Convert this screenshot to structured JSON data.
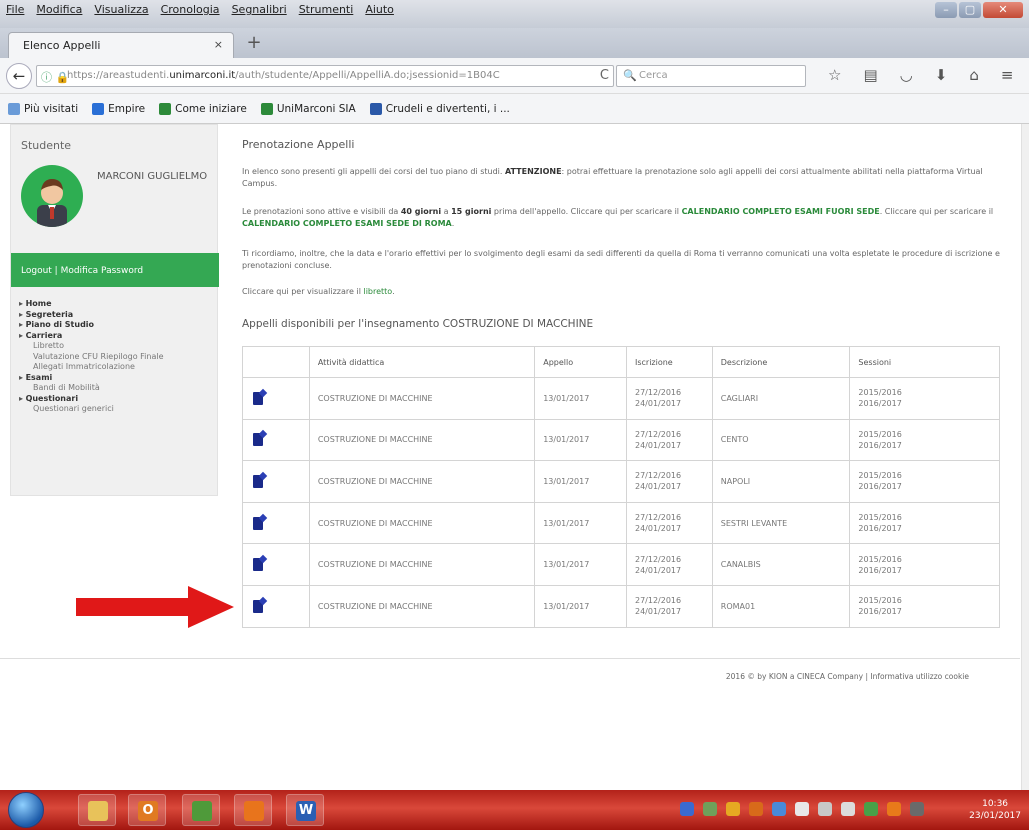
{
  "menu": [
    "File",
    "Modifica",
    "Visualizza",
    "Cronologia",
    "Segnalibri",
    "Strumenti",
    "Aiuto"
  ],
  "tab": {
    "title": "Elenco Appelli",
    "close": "×",
    "new": "+"
  },
  "nav": {
    "back": "←",
    "url_prefix": "https://areastudenti.",
    "url_domain": "unimarconi.it",
    "url_suffix": "/auth/studente/Appelli/AppelliA.do;jsessionid=1B04C",
    "reload": "C",
    "search_placeholder": "Cerca",
    "icons": [
      "star-icon",
      "bookmarks-icon",
      "pocket-icon",
      "download-icon",
      "home-icon",
      "menu-icon"
    ]
  },
  "bookmarks": [
    {
      "label": "Più visitati",
      "color": "#6a9bd8"
    },
    {
      "label": "Empire",
      "color": "#2a6fd6"
    },
    {
      "label": "Come iniziare",
      "color": "#2d8a3a"
    },
    {
      "label": "UniMarconi SIA",
      "color": "#2d8a3a"
    },
    {
      "label": "Crudeli e divertenti, i ...",
      "color": "#2a58a8"
    }
  ],
  "sidebar": {
    "heading": "Studente",
    "student_name": "MARCONI GUGLIELMO",
    "logout_link": "Logout | Modifica Password",
    "menu": [
      {
        "label": "Home",
        "type": "top"
      },
      {
        "label": "Segreteria",
        "type": "top"
      },
      {
        "label": "Piano di Studio",
        "type": "top"
      },
      {
        "label": "Carriera",
        "type": "top"
      },
      {
        "label": "Libretto",
        "type": "sub"
      },
      {
        "label": "Valutazione CFU Riepilogo Finale",
        "type": "sub"
      },
      {
        "label": "Allegati Immatricolazione",
        "type": "sub"
      },
      {
        "label": "Esami",
        "type": "top"
      },
      {
        "label": "Bandi di Mobilità",
        "type": "sub"
      },
      {
        "label": "Questionari",
        "type": "top"
      },
      {
        "label": "Questionari generici",
        "type": "sub"
      }
    ]
  },
  "main": {
    "title": "Prenotazione Appelli",
    "p1_a": "In elenco sono presenti gli appelli dei corsi del tuo piano di studi. ",
    "p1_b": "ATTENZIONE",
    "p1_c": ": potrai effettuare la prenotazione solo agli appelli dei corsi attualmente abilitati nella piattaforma Virtual Campus.",
    "p2_a": "Le prenotazioni sono attive e visibili da ",
    "p2_b": "40 giorni",
    "p2_c": " a ",
    "p2_d": "15 giorni",
    "p2_e": " prima dell'appello. Cliccare qui per scaricare il ",
    "p2_f": "CALENDARIO COMPLETO ESAMI FUORI SEDE",
    "p2_g": ". Cliccare qui per scaricare il ",
    "p2_h": "CALENDARIO COMPLETO ESAMI SEDE DI ROMA",
    "p2_i": ".",
    "p3": "Ti ricordiamo, inoltre, che la data e l'orario effettivi per lo svolgimento degli esami da sedi differenti da quella di Roma ti verranno comunicati una volta espletate le procedure di iscrizione e prenotazioni concluse.",
    "p4_a": "Cliccare qui per visualizzare il ",
    "p4_b": "libretto",
    "p4_c": ".",
    "section_title": "Appelli disponibili per l'insegnamento COSTRUZIONE DI MACCHINE"
  },
  "table": {
    "headers": [
      "",
      "Attività didattica",
      "Appello",
      "Iscrizione",
      "Descrizione",
      "Sessioni"
    ],
    "rows": [
      {
        "attivita": "COSTRUZIONE DI MACCHINE",
        "appello": "13/01/2017",
        "isc_da": "27/12/2016",
        "isc_a": "24/01/2017",
        "descrizione": "CAGLIARI",
        "sess1": "2015/2016",
        "sess2": "2016/2017"
      },
      {
        "attivita": "COSTRUZIONE DI MACCHINE",
        "appello": "13/01/2017",
        "isc_da": "27/12/2016",
        "isc_a": "24/01/2017",
        "descrizione": "CENTO",
        "sess1": "2015/2016",
        "sess2": "2016/2017"
      },
      {
        "attivita": "COSTRUZIONE DI MACCHINE",
        "appello": "13/01/2017",
        "isc_da": "27/12/2016",
        "isc_a": "24/01/2017",
        "descrizione": "NAPOLI",
        "sess1": "2015/2016",
        "sess2": "2016/2017"
      },
      {
        "attivita": "COSTRUZIONE DI MACCHINE",
        "appello": "13/01/2017",
        "isc_da": "27/12/2016",
        "isc_a": "24/01/2017",
        "descrizione": "SESTRI LEVANTE",
        "sess1": "2015/2016",
        "sess2": "2016/2017"
      },
      {
        "attivita": "COSTRUZIONE DI MACCHINE",
        "appello": "13/01/2017",
        "isc_da": "27/12/2016",
        "isc_a": "24/01/2017",
        "descrizione": "CANALBIS",
        "sess1": "2015/2016",
        "sess2": "2016/2017"
      },
      {
        "attivita": "COSTRUZIONE DI MACCHINE",
        "appello": "13/01/2017",
        "isc_da": "27/12/2016",
        "isc_a": "24/01/2017",
        "descrizione": "ROMA01",
        "sess1": "2015/2016",
        "sess2": "2016/2017"
      }
    ]
  },
  "footer": "2016 © by KION a CINECA Company | Informativa utilizzo cookie",
  "taskbar": {
    "apps": [
      {
        "name": "explorer",
        "glyph": "",
        "color": "#e8c25a"
      },
      {
        "name": "office",
        "glyph": "O",
        "color": "#e07a22"
      },
      {
        "name": "paint",
        "glyph": "",
        "color": "#4f9a3a"
      },
      {
        "name": "firefox",
        "glyph": "",
        "color": "#e8741c"
      },
      {
        "name": "word",
        "glyph": "W",
        "color": "#2b5fb3"
      }
    ],
    "tray_colors": [
      "#3a6ad0",
      "#6fa05a",
      "#e6a822",
      "#d86a1a",
      "#4a8ad8",
      "#e8e8e8",
      "#c8c8c8",
      "#dcdcdc",
      "#48a048",
      "#e87a1a",
      "#6a6a6a"
    ],
    "time": "10:36",
    "date": "23/01/2017"
  },
  "colors": {
    "accent_green": "#34a853",
    "taskbar_red": "#c6342a",
    "arrow_red": "#e01818"
  }
}
